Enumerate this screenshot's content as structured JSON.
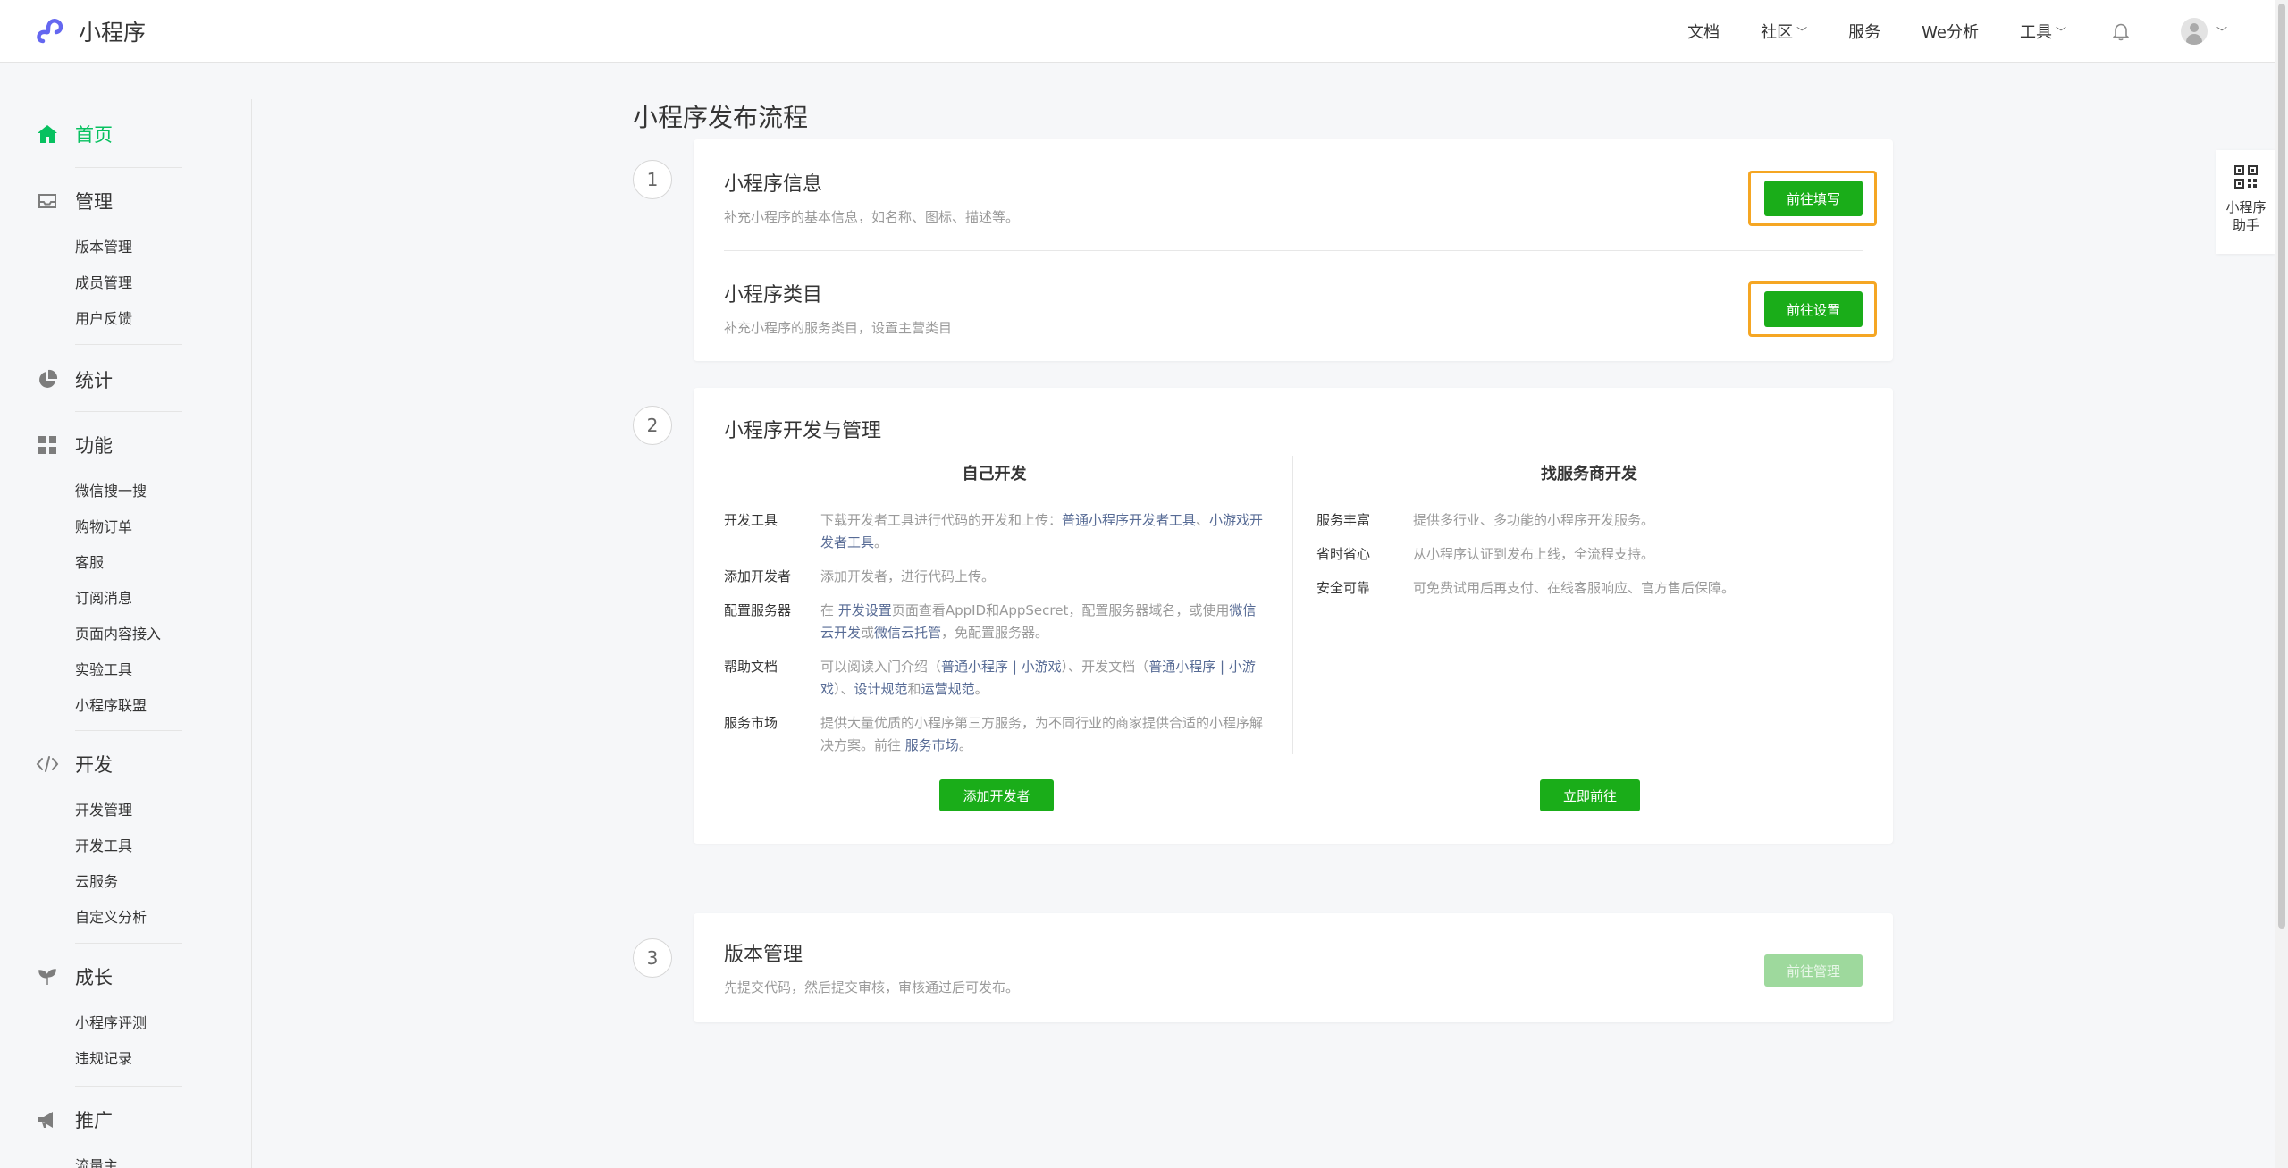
{
  "header": {
    "brand": "小程序",
    "nav": [
      "文档",
      "社区",
      "服务",
      "We分析",
      "工具"
    ]
  },
  "sidebar": {
    "home": "首页",
    "sections": [
      {
        "title": "管理",
        "icon": "inbox-icon",
        "items": [
          "版本管理",
          "成员管理",
          "用户反馈"
        ]
      },
      {
        "title": "统计",
        "icon": "pie-chart-icon",
        "items": []
      },
      {
        "title": "功能",
        "icon": "grid-icon",
        "items": [
          "微信搜一搜",
          "购物订单",
          "客服",
          "订阅消息",
          "页面内容接入",
          "实验工具",
          "小程序联盟"
        ]
      },
      {
        "title": "开发",
        "icon": "code-icon",
        "items": [
          "开发管理",
          "开发工具",
          "云服务",
          "自定义分析"
        ]
      },
      {
        "title": "成长",
        "icon": "sprout-icon",
        "items": [
          "小程序评测",
          "违规记录"
        ]
      },
      {
        "title": "推广",
        "icon": "megaphone-icon",
        "items": [
          "流量主"
        ]
      }
    ]
  },
  "main": {
    "title": "小程序发布流程",
    "step1": {
      "num": "1",
      "info_title": "小程序信息",
      "info_desc": "补充小程序的基本信息，如名称、图标、描述等。",
      "info_btn": "前往填写",
      "cat_title": "小程序类目",
      "cat_desc": "补充小程序的服务类目，设置主营类目",
      "cat_btn": "前往设置"
    },
    "step2": {
      "num": "2",
      "title": "小程序开发与管理",
      "left_title": "自己开发",
      "right_title": "找服务商开发",
      "rows": {
        "tools_label": "开发工具",
        "tools_text1": "下载开发者工具进行代码的开发和上传：",
        "tools_link1": "普通小程序开发者工具",
        "tools_sep": "、",
        "tools_link2": "小游戏开发者工具",
        "tools_end": "。",
        "dev_label": "添加开发者",
        "dev_text": "添加开发者，进行代码上传。",
        "server_label": "配置服务器",
        "server_text1": "在",
        "server_link1": "开发设置",
        "server_text2": "页面查看AppID和AppSecret，配置服务器域名，或使用",
        "server_link2": "微信云开发",
        "server_text3": "或",
        "server_link3": "微信云托管",
        "server_text4": "，免配置服务器。",
        "help_label": "帮助文档",
        "help_text1": "可以阅读入门介绍（",
        "help_link1": "普通小程序",
        "help_bar1": "|",
        "help_link2": "小游戏",
        "help_text2": "）、开发文档（",
        "help_link3": "普通小程序",
        "help_bar2": "|",
        "help_link4": "小游戏",
        "help_text3": "）、",
        "help_link5": "设计规范",
        "help_text4": "和",
        "help_link6": "运营规范",
        "help_end": "。",
        "market_label": "服务市场",
        "market_text1": "提供大量优质的小程序第三方服务，为不同行业的商家提供合适的小程序解决方案。前往",
        "market_link": "服务市场",
        "market_end": "。"
      },
      "right_rows": [
        {
          "label": "服务丰富",
          "text": "提供多行业、多功能的小程序开发服务。"
        },
        {
          "label": "省时省心",
          "text": "从小程序认证到发布上线，全流程支持。"
        },
        {
          "label": "安全可靠",
          "text": "可免费试用后再支付、在线客服响应、官方售后保障。"
        }
      ],
      "left_btn": "添加开发者",
      "right_btn": "立即前往"
    },
    "step3": {
      "num": "3",
      "title": "版本管理",
      "desc": "先提交代码，然后提交审核，审核通过后可发布。",
      "btn": "前往管理"
    }
  },
  "helper": {
    "label": "小程序助手"
  },
  "colors": {
    "accent": "#07c160",
    "button": "#1aad19",
    "highlight": "#f5a623",
    "link": "#576b95"
  }
}
